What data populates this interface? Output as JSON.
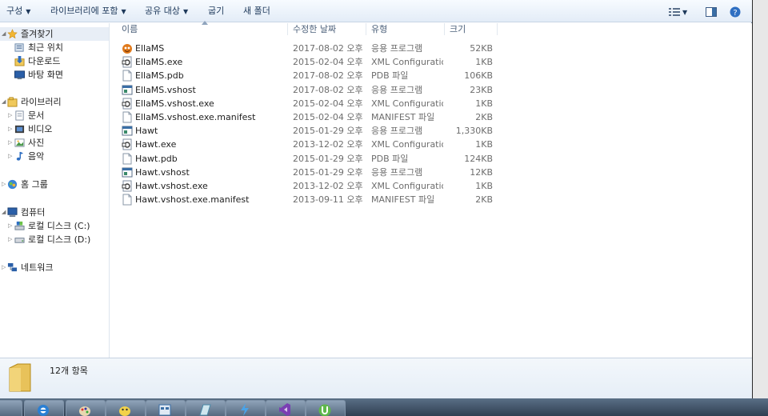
{
  "toolbar": {
    "organize": "구성",
    "include_library": "라이브러리에 포함",
    "share_with": "공유 대상",
    "burn": "굽기",
    "new_folder": "새 폴더"
  },
  "nav": {
    "favorites": "즐겨찾기",
    "recent": "최근 위치",
    "downloads": "다운로드",
    "desktop": "바탕 화면",
    "libraries": "라이브러리",
    "documents": "문서",
    "videos": "비디오",
    "pictures": "사진",
    "music": "음악",
    "homegroup": "홈 그룹",
    "computer": "컴퓨터",
    "disk_c": "로컬 디스크 (C:)",
    "disk_d": "로컬 디스크 (D:)",
    "network": "네트워크"
  },
  "columns": {
    "name": "이름",
    "date": "수정한 날짜",
    "type": "유형",
    "size": "크기"
  },
  "files": [
    {
      "name": "EllaMS",
      "date": "2017-08-02 오후...",
      "type": "응용 프로그램",
      "size": "52KB",
      "icon": "app-icon"
    },
    {
      "name": "EllaMS.exe",
      "date": "2015-02-04 오후...",
      "type": "XML Configuratio...",
      "size": "1KB",
      "icon": "config-icon"
    },
    {
      "name": "EllaMS.pdb",
      "date": "2017-08-02 오후...",
      "type": "PDB 파일",
      "size": "106KB",
      "icon": "file-icon"
    },
    {
      "name": "EllaMS.vshost",
      "date": "2017-08-02 오후...",
      "type": "응용 프로그램",
      "size": "23KB",
      "icon": "window-icon"
    },
    {
      "name": "EllaMS.vshost.exe",
      "date": "2015-02-04 오후...",
      "type": "XML Configuratio...",
      "size": "1KB",
      "icon": "config-icon"
    },
    {
      "name": "EllaMS.vshost.exe.manifest",
      "date": "2015-02-04 오후...",
      "type": "MANIFEST 파일",
      "size": "2KB",
      "icon": "file-icon"
    },
    {
      "name": "Hawt",
      "date": "2015-01-29 오후...",
      "type": "응용 프로그램",
      "size": "1,330KB",
      "icon": "window-icon"
    },
    {
      "name": "Hawt.exe",
      "date": "2013-12-02 오후...",
      "type": "XML Configuratio...",
      "size": "1KB",
      "icon": "config-icon"
    },
    {
      "name": "Hawt.pdb",
      "date": "2015-01-29 오후...",
      "type": "PDB 파일",
      "size": "124KB",
      "icon": "file-icon"
    },
    {
      "name": "Hawt.vshost",
      "date": "2015-01-29 오후...",
      "type": "응용 프로그램",
      "size": "12KB",
      "icon": "window-icon"
    },
    {
      "name": "Hawt.vshost.exe",
      "date": "2013-12-02 오후...",
      "type": "XML Configuratio...",
      "size": "1KB",
      "icon": "config-icon"
    },
    {
      "name": "Hawt.vshost.exe.manifest",
      "date": "2013-09-11 오후...",
      "type": "MANIFEST 파일",
      "size": "2KB",
      "icon": "file-icon"
    }
  ],
  "status": {
    "count": "12개 항목"
  },
  "colors": {
    "toolbar_text": "#1e395b",
    "meta_text": "#6d6d6d"
  }
}
